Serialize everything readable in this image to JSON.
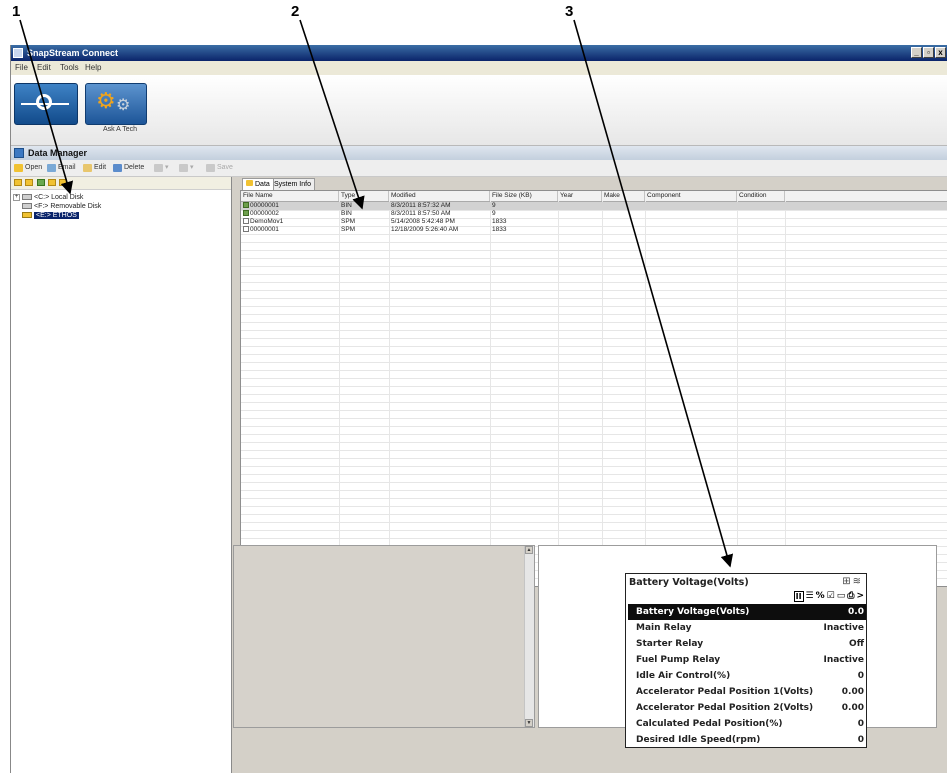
{
  "callouts": [
    "1",
    "2",
    "3"
  ],
  "window": {
    "title": "SnapStream Connect",
    "controls": [
      "_",
      "▫",
      "x"
    ]
  },
  "menu": [
    "File",
    "Edit",
    "Tools",
    "Help"
  ],
  "ribbon": {
    "ask_label": "Ask A Tech"
  },
  "data_manager": {
    "title": "Data Manager"
  },
  "toolbar": {
    "open": "Open",
    "email": "Email",
    "edit": "Edit",
    "delete": "Delete",
    "save": "Save"
  },
  "tree": [
    {
      "expander": "+",
      "label": "<C:> Local Disk"
    },
    {
      "expander": "",
      "label": "<F:> Removable Disk"
    },
    {
      "expander": "",
      "label": "<E:> ETHOS"
    }
  ],
  "tabs": [
    "Data",
    "System Info"
  ],
  "table": {
    "columns": [
      "File Name",
      "Type",
      "Modified",
      "File Size (KB)",
      "Year",
      "Make",
      "Component",
      "Condition"
    ],
    "rows": [
      [
        "00000001",
        "BIN",
        "8/3/2011 8:57:32 AM",
        "9"
      ],
      [
        "00000002",
        "BIN",
        "8/3/2011 8:57:50 AM",
        "9"
      ],
      [
        "DemoMov1",
        "SPM",
        "5/14/2008 5:42:48 PM",
        "1833"
      ],
      [
        "00000001",
        "SPM",
        "12/18/2009 5:26:40 AM",
        "1833"
      ]
    ]
  },
  "data_panel": {
    "title": "Battery Voltage(Volts)",
    "rows": [
      {
        "label": "Battery Voltage(Volts)",
        "value": "0.0"
      },
      {
        "label": "Main Relay",
        "value": "Inactive"
      },
      {
        "label": "Starter Relay",
        "value": "Off"
      },
      {
        "label": "Fuel Pump Relay",
        "value": "Inactive"
      },
      {
        "label": "Idle Air Control(%)",
        "value": "0"
      },
      {
        "label": "Accelerator Pedal Position 1(Volts)",
        "value": "0.00"
      },
      {
        "label": "Accelerator Pedal Position 2(Volts)",
        "value": "0.00"
      },
      {
        "label": "Calculated Pedal Position(%)",
        "value": "0"
      },
      {
        "label": "Desired Idle Speed(rpm)",
        "value": "0"
      }
    ]
  }
}
